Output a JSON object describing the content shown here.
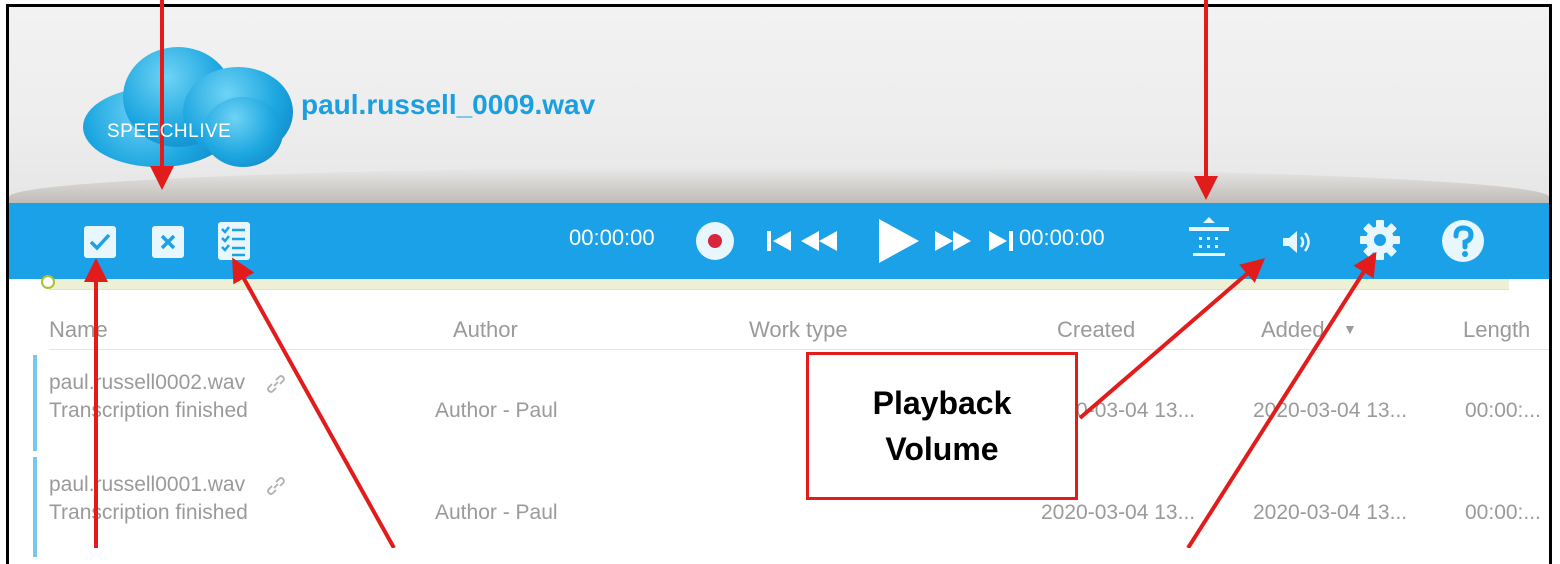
{
  "app": {
    "logo_text": "SPEECHLIVE",
    "file_title": "paul.russell_0009.wav"
  },
  "player": {
    "time_start": "00:00:00",
    "time_end": "00:00:00"
  },
  "icons": {
    "finish": "checkbox-check-icon",
    "cancel": "checkbox-x-icon",
    "checklist": "checklist-icon",
    "record": "record-icon",
    "skip_start": "skip-to-start-icon",
    "rewind": "rewind-icon",
    "play": "play-icon",
    "forward": "fast-forward-icon",
    "skip_end": "skip-to-end-icon",
    "split": "split-icon",
    "volume": "volume-icon",
    "settings": "gear-icon",
    "help": "help-icon",
    "link": "link-icon"
  },
  "table": {
    "columns": [
      "Name",
      "Author",
      "Work type",
      "Created",
      "Added",
      "Length"
    ],
    "sorted_column_marker": "▼",
    "rows": [
      {
        "name": "paul.russell0002.wav",
        "status": "Transcription finished",
        "author": "Author - Paul",
        "created": "2020-03-04 13...",
        "added": "2020-03-04 13...",
        "length": "00:00:..."
      },
      {
        "name": "paul.russell0001.wav",
        "status": "Transcription finished",
        "author": "Author - Paul",
        "created": "2020-03-04 13...",
        "added": "2020-03-04 13...",
        "length": "00:00:..."
      }
    ]
  },
  "annotation": {
    "callout_line1": "Playback",
    "callout_line2": "Volume"
  },
  "colors": {
    "toolbar": "#1ba1e8",
    "title": "#1a9fe0",
    "annotation": "#e21b1b",
    "row_marker": "#76c8ef"
  }
}
